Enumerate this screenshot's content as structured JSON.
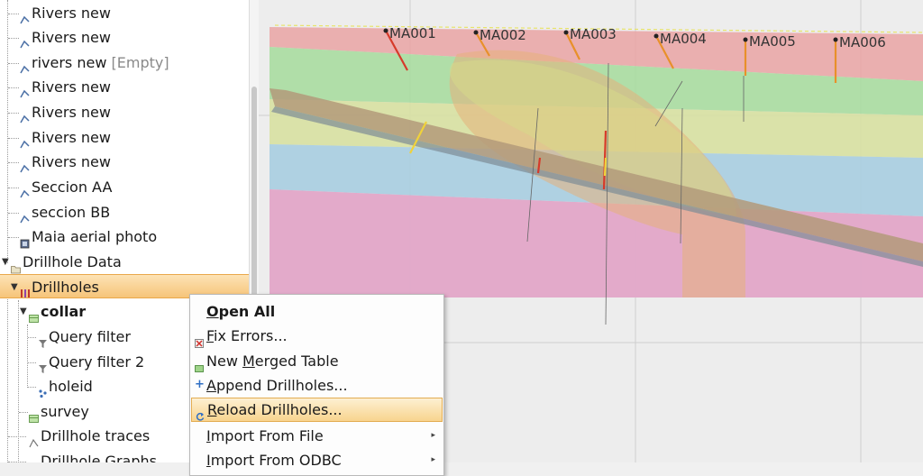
{
  "tree": {
    "items": [
      {
        "label": "Rivers new"
      },
      {
        "label": "Rivers new"
      },
      {
        "label": "rivers new",
        "suffix": "[Empty]"
      },
      {
        "label": "Rivers new"
      },
      {
        "label": "Rivers new"
      },
      {
        "label": "Rivers new"
      },
      {
        "label": "Rivers new"
      },
      {
        "label": "Seccion AA"
      },
      {
        "label": "seccion BB"
      },
      {
        "label": "Maia aerial photo"
      },
      {
        "label": "Drillhole Data"
      },
      {
        "label": "Drillholes"
      },
      {
        "label": "collar"
      },
      {
        "label": "Query filter"
      },
      {
        "label": "Query filter 2"
      },
      {
        "label": "holeid"
      },
      {
        "label": "survey"
      },
      {
        "label": "Drillhole traces"
      },
      {
        "label": "Drillhole Graphs"
      }
    ]
  },
  "viewport": {
    "collars": [
      "MA001",
      "MA002",
      "MA003",
      "MA004",
      "MA005",
      "MA006"
    ]
  },
  "menu": {
    "items": [
      {
        "u": "O",
        "rest": "pen All"
      },
      {
        "u": "F",
        "rest": "ix Errors..."
      },
      {
        "pre": "New ",
        "u": "M",
        "rest": "erged Table"
      },
      {
        "u": "A",
        "rest": "ppend Drillholes..."
      },
      {
        "u": "R",
        "rest": "eload Drillholes..."
      },
      {
        "u": "I",
        "rest": "mport From File"
      },
      {
        "u": "I",
        "rest": "mport From ODBC"
      }
    ]
  },
  "colors": {
    "selection": "#f6c479",
    "accent": "#e9a84b"
  }
}
